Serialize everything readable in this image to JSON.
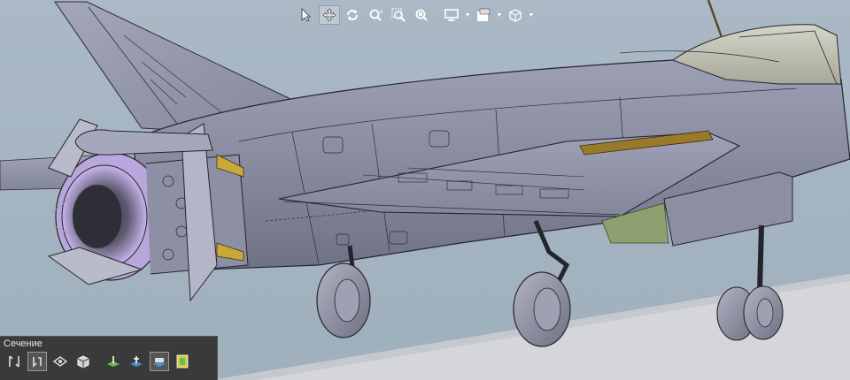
{
  "app": {
    "view_toolbar": {
      "buttons": [
        {
          "icon": "select-arrow-icon",
          "active": false
        },
        {
          "icon": "pan-move-icon",
          "active": true
        },
        {
          "icon": "rotate-icon",
          "active": false
        },
        {
          "icon": "zoom-icon",
          "active": false
        },
        {
          "icon": "zoom-window-icon",
          "active": false
        },
        {
          "icon": "zoom-fit-icon",
          "active": false
        },
        {
          "icon": "display-mode-icon",
          "active": false,
          "dropdown": true
        },
        {
          "icon": "appearance-icon",
          "active": false,
          "dropdown": true
        },
        {
          "icon": "view-orientation-cube-icon",
          "active": false,
          "dropdown": true
        }
      ]
    },
    "section_panel": {
      "title": "Сечение",
      "buttons": [
        {
          "icon": "section-tool-1-icon",
          "active": false
        },
        {
          "icon": "section-tool-2-icon",
          "active": true
        },
        {
          "icon": "section-tool-3-icon",
          "active": false
        },
        {
          "icon": "section-box-icon",
          "active": false
        },
        {
          "icon": "section-plane-1-icon",
          "active": false
        },
        {
          "icon": "section-plane-2-icon",
          "active": false
        },
        {
          "icon": "section-plane-3-icon",
          "active": true
        },
        {
          "icon": "section-settings-icon",
          "active": false
        }
      ]
    },
    "colors": {
      "background": "#a7b6c2",
      "fuselage": "#8e90a4",
      "panel_bg": "#3a3a3a",
      "engine_interior": "#c8b8e8",
      "orange_part": "#9a7a2a",
      "green_part": "#8fa070"
    }
  }
}
